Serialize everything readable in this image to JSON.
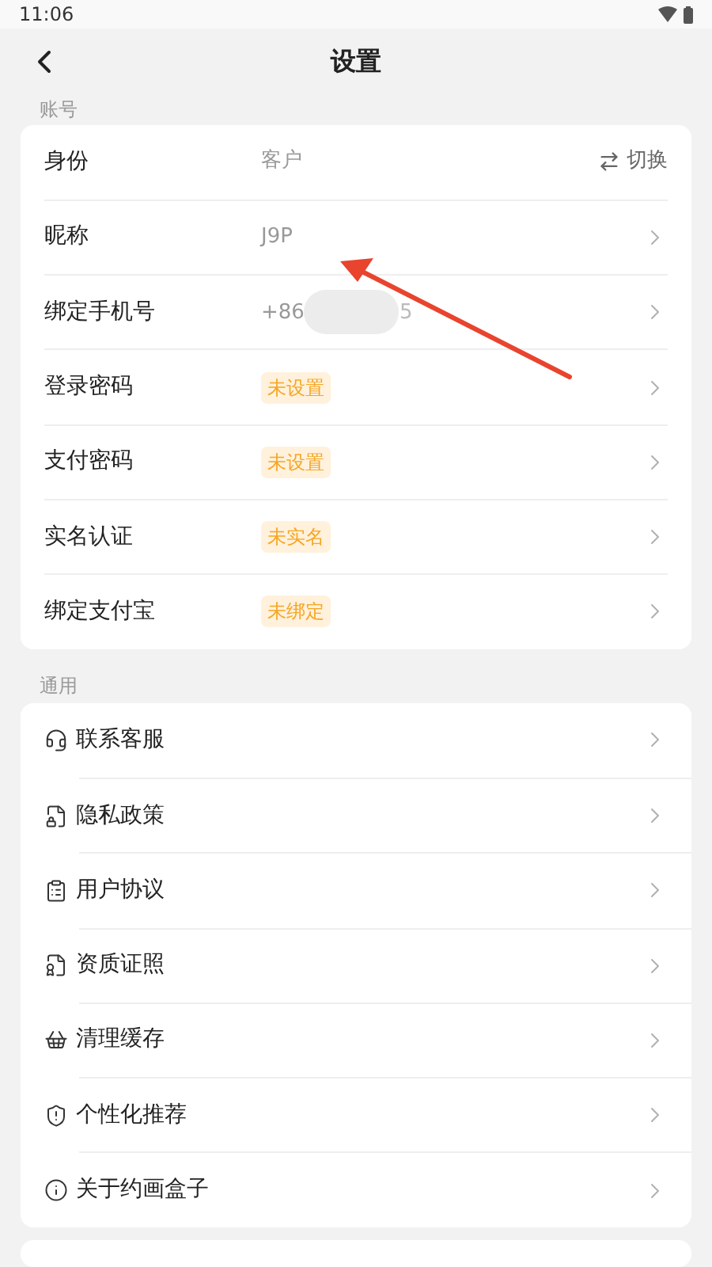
{
  "status_bar": {
    "time": "11:06"
  },
  "header": {
    "title": "设置"
  },
  "account": {
    "label": "账号",
    "rows": [
      {
        "label": "身份",
        "kind": "text",
        "value": "客户",
        "action": "切换"
      },
      {
        "label": "昵称",
        "kind": "text",
        "value": "J9P"
      },
      {
        "label": "绑定手机号",
        "kind": "redacted",
        "value": "+86",
        "value_end": "5"
      },
      {
        "label": "登录密码",
        "kind": "tag",
        "value": "未设置"
      },
      {
        "label": "支付密码",
        "kind": "tag",
        "value": "未设置"
      },
      {
        "label": "实名认证",
        "kind": "tag",
        "value": "未实名"
      },
      {
        "label": "绑定支付宝",
        "kind": "tag",
        "value": "未绑定"
      }
    ]
  },
  "general": {
    "label": "通用",
    "rows": [
      {
        "label": "联系客服"
      },
      {
        "label": "隐私政策"
      },
      {
        "label": "用户协议"
      },
      {
        "label": "资质证照"
      },
      {
        "label": "清理缓存"
      },
      {
        "label": "个性化推荐"
      },
      {
        "label": "关于约画盒子"
      }
    ]
  }
}
